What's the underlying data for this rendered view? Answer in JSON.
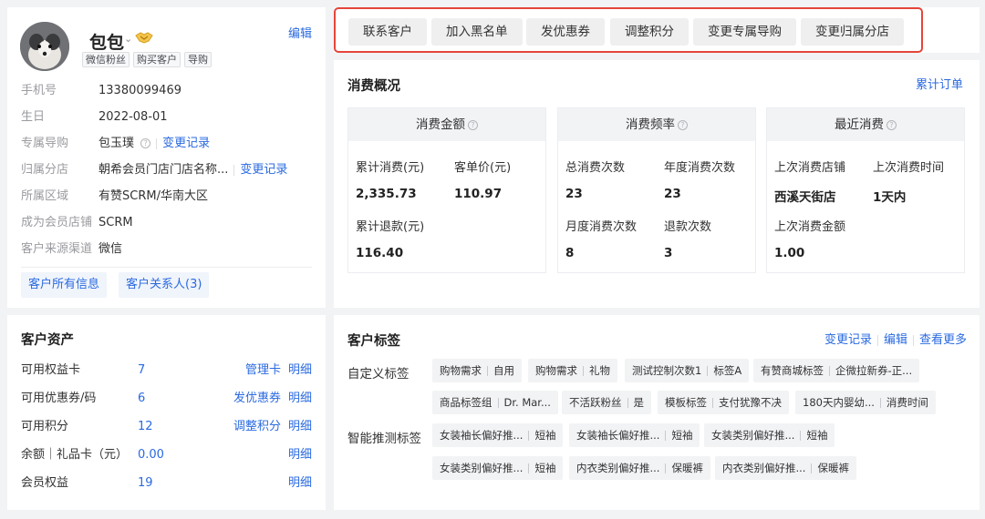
{
  "profile": {
    "name": "包包",
    "edit": "编辑",
    "tags": [
      "微信粉丝",
      "购买客户",
      "导购"
    ],
    "rows": [
      {
        "label": "手机号",
        "value": "13380099469"
      },
      {
        "label": "生日",
        "value": "2022-08-01"
      },
      {
        "label": "专属导购",
        "value": "包玉璞",
        "link": "变更记录"
      },
      {
        "label": "归属分店",
        "value": "朝希会员门店门店名称...",
        "link": "变更记录"
      },
      {
        "label": "所属区域",
        "value": "有赞SCRM/华南大区"
      },
      {
        "label": "成为会员店铺",
        "value": "SCRM"
      },
      {
        "label": "客户来源渠道",
        "value": "微信"
      }
    ],
    "btn_all_info": "客户所有信息",
    "btn_contacts": "客户关系人(3)"
  },
  "assets": {
    "title": "客户资产",
    "rows": [
      {
        "label": "可用权益卡",
        "value": "7",
        "action": "管理卡",
        "detail": "明细"
      },
      {
        "label": "可用优惠券/码",
        "value": "6",
        "action": "发优惠券",
        "detail": "明细"
      },
      {
        "label": "可用积分",
        "value": "12",
        "action": "调整积分",
        "detail": "明细"
      },
      {
        "label": "余额｜礼品卡（元）",
        "value": "0.00",
        "action": "",
        "detail": "明细"
      },
      {
        "label": "会员权益",
        "value": "19",
        "action": "",
        "detail": "明细"
      }
    ]
  },
  "actions": [
    "联系客户",
    "加入黑名单",
    "发优惠券",
    "调整积分",
    "变更专属导购",
    "变更归属分店"
  ],
  "consume": {
    "title": "消费概况",
    "cum_order": "累计订单",
    "boxes": [
      {
        "title": "消费金额",
        "cells": [
          {
            "label": "累计消费(元)",
            "value": "2,335.73"
          },
          {
            "label": "客单价(元)",
            "value": "110.97"
          },
          {
            "label": "累计退款(元)",
            "value": "116.40"
          }
        ]
      },
      {
        "title": "消费频率",
        "cells": [
          {
            "label": "总消费次数",
            "value": "23"
          },
          {
            "label": "年度消费次数",
            "value": "23"
          },
          {
            "label": "月度消费次数",
            "value": "8"
          },
          {
            "label": "退款次数",
            "value": "3"
          }
        ]
      },
      {
        "title": "最近消费",
        "cells": [
          {
            "label": "上次消费店铺",
            "value": "西溪天街店"
          },
          {
            "label": "上次消费时间",
            "value": "1天内"
          },
          {
            "label": "上次消费金额",
            "value": "1.00"
          }
        ]
      }
    ]
  },
  "tags": {
    "title": "客户标签",
    "change_log": "变更记录",
    "edit": "编辑",
    "more": "查看更多",
    "custom_label": "自定义标签",
    "smart_label": "智能推测标签",
    "custom": [
      [
        "购物需求",
        "自用"
      ],
      [
        "购物需求",
        "礼物"
      ],
      [
        "测试控制次数1",
        "标签A"
      ],
      [
        "有赞商城标签",
        "企微拉新券-正..."
      ],
      [
        "商品标签组",
        "Dr. Mar..."
      ],
      [
        "不活跃粉丝",
        "是"
      ],
      [
        "模板标签",
        "支付犹豫不决"
      ],
      [
        "180天内婴幼...",
        "消费时间"
      ]
    ],
    "smart": [
      [
        "女装袖长偏好推...",
        "短袖"
      ],
      [
        "女装袖长偏好推...",
        "短袖"
      ],
      [
        "女装类别偏好推...",
        "短袖"
      ],
      [
        "女装类别偏好推...",
        "短袖"
      ],
      [
        "内衣类别偏好推...",
        "保暖裤"
      ],
      [
        "内衣类别偏好推...",
        "保暖裤"
      ]
    ]
  }
}
